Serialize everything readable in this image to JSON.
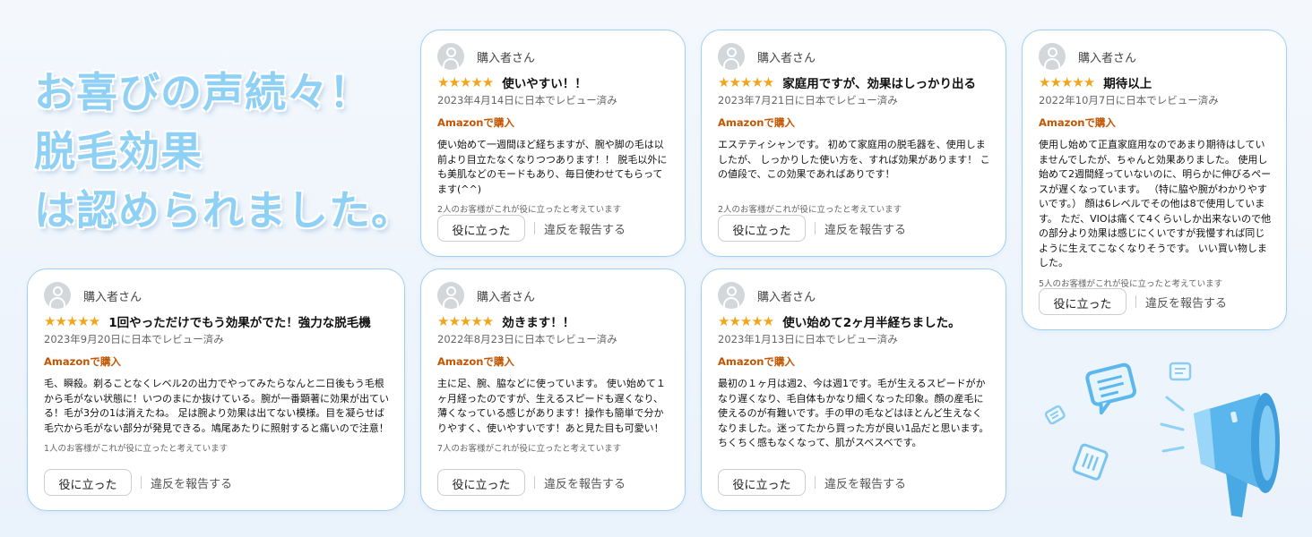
{
  "headline": [
    "お喜びの声続々！",
    "脱毛効果",
    "は認められました。"
  ],
  "common": {
    "stars": "★★★★★",
    "verified": "Amazonで購入",
    "helpful_button": "役に立った",
    "report_link": "違反を報告する"
  },
  "reviews": [
    {
      "name": "購入者さん",
      "title": "使いやすい！！",
      "date": "2023年4月14日に日本でレビュー済み",
      "body": "使い始めて一週間ほど経ちますが、腕や脚の毛は以前より目立たなくなりつつあります！！ 脱毛以外にも美肌などのモードもあり、毎日使わせてもらってます(^^)",
      "helpful": "2人のお客様がこれが役に立ったと考えています"
    },
    {
      "name": "購入者さん",
      "title": "家庭用ですが、効果はしっかり出る",
      "date": "2023年7月21日に日本でレビュー済み",
      "body": "エステティシャンです。 初めて家庭用の脱毛器を、使用しましたが、 しっかりした使い方を、すれば効果があります！ この値段で、この効果であればありです！",
      "helpful": "2人のお客様がこれが役に立ったと考えています"
    },
    {
      "name": "購入者さん",
      "title": "期待以上",
      "date": "2022年10月7日に日本でレビュー済み",
      "body": "使用し始めて正直家庭用なのであまり期待はしていませんでしたが、ちゃんと効果ありました。 使用し始めて2週間経っていないのに、明らかに伸びるペースが遅くなっています。 （特に脇や腕がわかりやすいです。） 顔は6レベルでその他は8で使用しています。 ただ、VIOは痛くて4くらいしか出来ないので他の部分より効果は感じにくいですが我慢すれば同じように生えてこなくなりそうです。 いい買い物しました。",
      "helpful": "5人のお客様がこれが役に立ったと考えています"
    },
    {
      "name": "購入者さん",
      "title": "1回やっただけでもう効果がでた！強力な脱毛機",
      "date": "2023年9月20日に日本でレビュー済み",
      "body": "毛、瞬殺。剃ることなくレベル2の出力でやってみたらなんと二日後もう毛根から毛がない状態に！いつのまにか抜けている。腕が一番顕著に効果が出ている！毛が3分の1は消えたね。 足は腕より効果は出てない模様。目を凝らせば毛穴から毛がない部分が発見できる。鳩尾あたりに照射すると痛いので注意！",
      "helpful": "1人のお客様がこれが役に立ったと考えています"
    },
    {
      "name": "購入者さん",
      "title": "効きます！！",
      "date": "2022年8月23日に日本でレビュー済み",
      "body": "主に足、腕、脇などに使っています。 使い始めて１ヶ月経ったのですが、生えるスピードも遅くなり、薄くなっている感じがあります！操作も簡単で分かりやすく、使いやすいです！あと見た目も可愛い！",
      "helpful": "7人のお客様がこれが役に立ったと考えています"
    },
    {
      "name": "購入者さん",
      "title": "使い始めて2ヶ月半経ちました。",
      "date": "2023年1月13日に日本でレビュー済み",
      "body": "最初の１ヶ月は週2、今は週1です。毛が生えるスピードがかなり遅くなり、毛自体もかなり細くなった印象。顔の産毛に使えるのが有難いです。手の甲の毛などはほとんど生えなくなりました。迷ってたから買った方が良い1品だと思います。ちくちく感もなくなって、肌がスベスベです。",
      "helpful": ""
    }
  ],
  "colors": {
    "headline": "#8fd0f5",
    "star": "#f0a51a",
    "verified": "#c45500",
    "card_border": "#9fcff0"
  },
  "icons": [
    "megaphone-icon",
    "speech-bubble-icon"
  ]
}
